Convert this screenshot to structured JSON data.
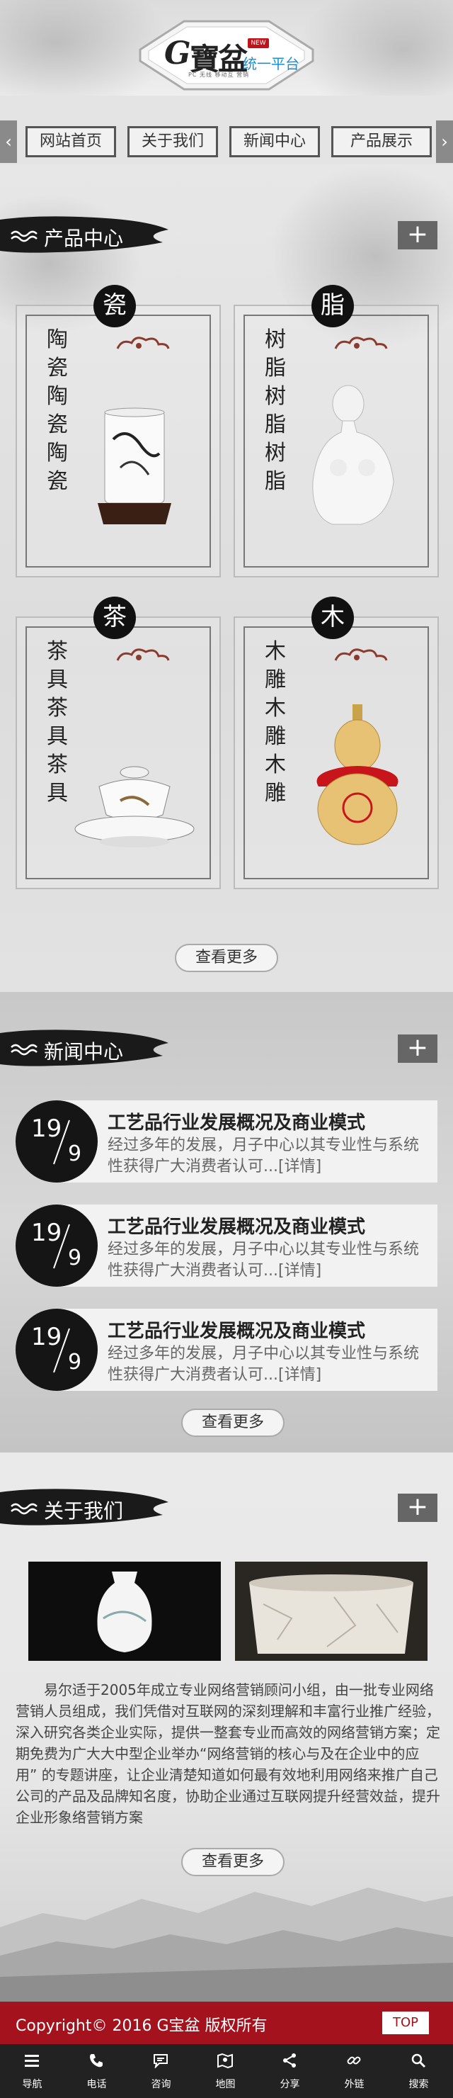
{
  "header": {
    "logo_letter": "G",
    "logo_chinese": "寶盆",
    "logo_badge": "NEW",
    "logo_slogan": "统一平台",
    "logo_subtitle": "PC 无线 移动互 营销"
  },
  "nav": {
    "prev_arrow": "‹",
    "next_arrow": "›",
    "items": [
      "网站首页",
      "关于我们",
      "新闻中心",
      "产品展示"
    ]
  },
  "products": {
    "title": "产品中心",
    "plus": "+",
    "more_label": "查看更多",
    "items": [
      {
        "badge": "瓷",
        "text": "陶瓷陶瓷陶瓷"
      },
      {
        "badge": "脂",
        "text": "树脂树脂树脂"
      },
      {
        "badge": "茶",
        "text": "茶具茶具茶具"
      },
      {
        "badge": "木",
        "text": "木雕木雕木雕"
      }
    ]
  },
  "news": {
    "title": "新闻中心",
    "plus": "+",
    "more_label": "查看更多",
    "items": [
      {
        "day": "19",
        "month": "9",
        "title": "工艺品行业发展概况及商业模式",
        "desc": "经过多年的发展，月子中心以其专业性与系统性获得广大消费者认可...[详情]"
      },
      {
        "day": "19",
        "month": "9",
        "title": "工艺品行业发展概况及商业模式",
        "desc": "经过多年的发展，月子中心以其专业性与系统性获得广大消费者认可...[详情]"
      },
      {
        "day": "19",
        "month": "9",
        "title": "工艺品行业发展概况及商业模式",
        "desc": "经过多年的发展，月子中心以其专业性与系统性获得广大消费者认可...[详情]"
      }
    ]
  },
  "about": {
    "title": "关于我们",
    "plus": "+",
    "more_label": "查看更多",
    "text": "易尔适于2005年成立专业网络营销顾问小组，由一批专业网络营销人员组成，我们凭借对互联网的深刻理解和丰富行业推广经验，深入研究各类企业实际，提供一整套专业而高效的网络营销方案；定期免费为广大大中型企业举办“网络营销的核心与及在企业中的应用” 的专题讲座，让企业清楚知道如何最有效地利用网络来推广自己公司的产品及品牌知名度，协助企业通过互联网提升经营效益，提升企业形象络营销方案"
  },
  "footer": {
    "copyright": "Copyright© 2016  G宝盆 版权所有",
    "top_label": "TOP"
  },
  "tabbar": [
    {
      "icon": "menu-icon",
      "label": "导航"
    },
    {
      "icon": "phone-icon",
      "label": "电话"
    },
    {
      "icon": "message-icon",
      "label": "咨询"
    },
    {
      "icon": "map-icon",
      "label": "地图"
    },
    {
      "icon": "share-icon",
      "label": "分享"
    },
    {
      "icon": "link-icon",
      "label": "外链"
    },
    {
      "icon": "search-icon",
      "label": "搜索"
    }
  ],
  "colors": {
    "footer_red": "#a4131d",
    "logo_blue": "#1a8fd6",
    "badge_red": "#c0141b"
  }
}
